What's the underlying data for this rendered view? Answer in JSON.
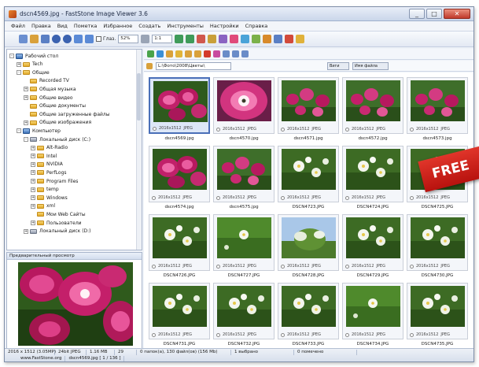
{
  "window": {
    "title": "dscn4569.jpg - FastStone Image Viewer 3.6",
    "controls": [
      "_",
      "□",
      "✕"
    ]
  },
  "menu": [
    "Файл",
    "Правка",
    "Вид",
    "Пометка",
    "Избранное",
    "Создать",
    "Инструменты",
    "Настройки",
    "Справка"
  ],
  "toolbar": {
    "checkbox_label": "Глаз.",
    "zoom_value": "52%",
    "field2": "1:1"
  },
  "tree": {
    "items": [
      {
        "label": "Рабочий стол",
        "exp": "-",
        "type": "pc"
      },
      {
        "label": "Tech",
        "exp": "+",
        "type": "folder"
      },
      {
        "label": "Общие",
        "exp": "-",
        "type": "folder"
      },
      {
        "label": "Recorded TV",
        "exp": "",
        "type": "folder"
      },
      {
        "label": "Общая музыка",
        "exp": "+",
        "type": "folder"
      },
      {
        "label": "Общие видео",
        "exp": "+",
        "type": "folder"
      },
      {
        "label": "Общие документы",
        "exp": "",
        "type": "folder"
      },
      {
        "label": "Общие загруженные файлы",
        "exp": "",
        "type": "folder"
      },
      {
        "label": "Общие изображения",
        "exp": "+",
        "type": "folder"
      },
      {
        "label": "Компьютер",
        "exp": "-",
        "type": "pc"
      },
      {
        "label": "Локальный диск (C:)",
        "exp": "-",
        "type": "drive"
      },
      {
        "label": "Alt-Radio",
        "exp": "+",
        "type": "folder"
      },
      {
        "label": "Intel",
        "exp": "+",
        "type": "folder"
      },
      {
        "label": "NVIDIA",
        "exp": "+",
        "type": "folder"
      },
      {
        "label": "PerfLogs",
        "exp": "+",
        "type": "folder"
      },
      {
        "label": "Program Files",
        "exp": "+",
        "type": "folder"
      },
      {
        "label": "temp",
        "exp": "+",
        "type": "folder"
      },
      {
        "label": "Windows",
        "exp": "+",
        "type": "folder"
      },
      {
        "label": "xml",
        "exp": "+",
        "type": "folder"
      },
      {
        "label": "Мои Web Сайты",
        "exp": "",
        "type": "folder"
      },
      {
        "label": "Пользователи",
        "exp": "+",
        "type": "folder"
      },
      {
        "label": "Локальный диск (D:)",
        "exp": "+",
        "type": "drive"
      }
    ]
  },
  "preview": {
    "title": "Предварительный просмотр"
  },
  "pathbar": {
    "path": "L:\\Фото\\2008\\Цветы\\",
    "sort_label": "Виги",
    "filter_label": "Имя файла"
  },
  "thumbnails": [
    {
      "name": "dscn4569.jpg",
      "info": "2016x1512",
      "fmt": "JPEG",
      "scene": "tulips-top",
      "selected": true
    },
    {
      "name": "dscn4570.jpg",
      "info": "2016x1512",
      "fmt": "JPEG",
      "scene": "tulip-macro",
      "selected": false
    },
    {
      "name": "dscn4571.jpg",
      "info": "2016x1512",
      "fmt": "JPEG",
      "scene": "tulips-field",
      "selected": false
    },
    {
      "name": "dscn4572.jpg",
      "info": "2016x1512",
      "fmt": "JPEG",
      "scene": "tulips-field",
      "selected": false
    },
    {
      "name": "dscn4573.jpg",
      "info": "2016x1512",
      "fmt": "JPEG",
      "scene": "tulips-field",
      "selected": false
    },
    {
      "name": "dscn4574.jpg",
      "info": "2016x1512",
      "fmt": "JPEG",
      "scene": "tulips-top",
      "selected": false
    },
    {
      "name": "dscn4575.jpg",
      "info": "2016x1512",
      "fmt": "JPEG",
      "scene": "tulips-field",
      "selected": false
    },
    {
      "name": "DSCN4723.JPG",
      "info": "2016x1512",
      "fmt": "JPEG",
      "scene": "white-flowers",
      "selected": false
    },
    {
      "name": "DSCN4724.JPG",
      "info": "2016x1512",
      "fmt": "JPEG",
      "scene": "white-flowers",
      "selected": false
    },
    {
      "name": "DSCN4725.JPG",
      "info": "2016x1512",
      "fmt": "JPEG",
      "scene": "white-flowers",
      "selected": false
    },
    {
      "name": "DSCN4726.JPG",
      "info": "2016x1512",
      "fmt": "JPEG",
      "scene": "white-flowers",
      "selected": false
    },
    {
      "name": "DSCN4727.JPG",
      "info": "2016x1512",
      "fmt": "JPEG",
      "scene": "green-grass",
      "selected": false
    },
    {
      "name": "DSCN4728.JPG",
      "info": "2016x1512",
      "fmt": "JPEG",
      "scene": "sky-tree",
      "selected": false
    },
    {
      "name": "DSCN4729.JPG",
      "info": "2016x1512",
      "fmt": "JPEG",
      "scene": "white-flowers",
      "selected": false
    },
    {
      "name": "DSCN4730.JPG",
      "info": "2016x1512",
      "fmt": "JPEG",
      "scene": "white-flowers",
      "selected": false
    },
    {
      "name": "DSCN4731.JPG",
      "info": "2016x1512",
      "fmt": "JPEG",
      "scene": "white-flowers",
      "selected": false
    },
    {
      "name": "DSCN4732.JPG",
      "info": "2016x1512",
      "fmt": "JPEG",
      "scene": "white-flowers",
      "selected": false
    },
    {
      "name": "DSCN4733.JPG",
      "info": "2016x1512",
      "fmt": "JPEG",
      "scene": "white-flowers",
      "selected": false
    },
    {
      "name": "DSCN4734.JPG",
      "info": "2016x1512",
      "fmt": "JPEG",
      "scene": "green-grass",
      "selected": false
    },
    {
      "name": "DSCN4735.JPG",
      "info": "2016x1512",
      "fmt": "JPEG",
      "scene": "white-flowers",
      "selected": false
    }
  ],
  "badge": {
    "text": "FREE"
  },
  "status": {
    "image_info": "2016 x 1512 (3.05MP)",
    "bit_depth": "24bit JPEG",
    "file_size": "1.16 MB",
    "zoom": "29",
    "folder_info": "0 папок(а), 130 файл(ов) (156 Mb)",
    "selected": "1 выбрано",
    "marked": "0 помечено",
    "website": "www.FastStone.org",
    "current": "dscn4569.jpg [ 1 / 136 ]"
  },
  "colors": {
    "accent": "#4a6fb8",
    "badge": "#d0231a"
  }
}
